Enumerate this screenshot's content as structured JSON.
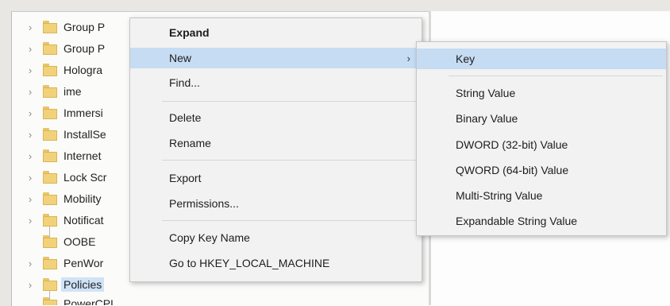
{
  "tree": {
    "items": [
      {
        "label": "Group P",
        "expandable": true
      },
      {
        "label": "Group P",
        "expandable": true
      },
      {
        "label": "Hologra",
        "expandable": true
      },
      {
        "label": "ime",
        "expandable": true
      },
      {
        "label": "Immersi",
        "expandable": true
      },
      {
        "label": "InstallSe",
        "expandable": true
      },
      {
        "label": "Internet",
        "expandable": true
      },
      {
        "label": "Lock Scr",
        "expandable": true
      },
      {
        "label": "Mobility",
        "expandable": true
      },
      {
        "label": "Notificat",
        "expandable": true
      },
      {
        "label": "OOBE",
        "expandable": false
      },
      {
        "label": "PenWor",
        "expandable": true
      },
      {
        "label": "Policies",
        "expandable": true,
        "selected": true
      },
      {
        "label": "PowerCPL",
        "expandable": false
      }
    ]
  },
  "context_menu": {
    "expand": "Expand",
    "new": "New",
    "find": "Find...",
    "delete": "Delete",
    "rename": "Rename",
    "export": "Export",
    "permissions": "Permissions...",
    "copy_key_name": "Copy Key Name",
    "goto": "Go to HKEY_LOCAL_MACHINE"
  },
  "new_submenu": {
    "key": "Key",
    "string_value": "String Value",
    "binary_value": "Binary Value",
    "dword_value": "DWORD (32-bit) Value",
    "qword_value": "QWORD (64-bit) Value",
    "multi_string_value": "Multi-String Value",
    "expandable_string_value": "Expandable String Value"
  },
  "icons": {
    "chevron": "chevron-right-icon",
    "folder": "folder-icon",
    "submenu_arrow": "submenu-arrow-icon"
  },
  "colors": {
    "highlight": "#c5dcf3",
    "menu_bg": "#f2f2f2",
    "folder": "#f1d27a"
  }
}
